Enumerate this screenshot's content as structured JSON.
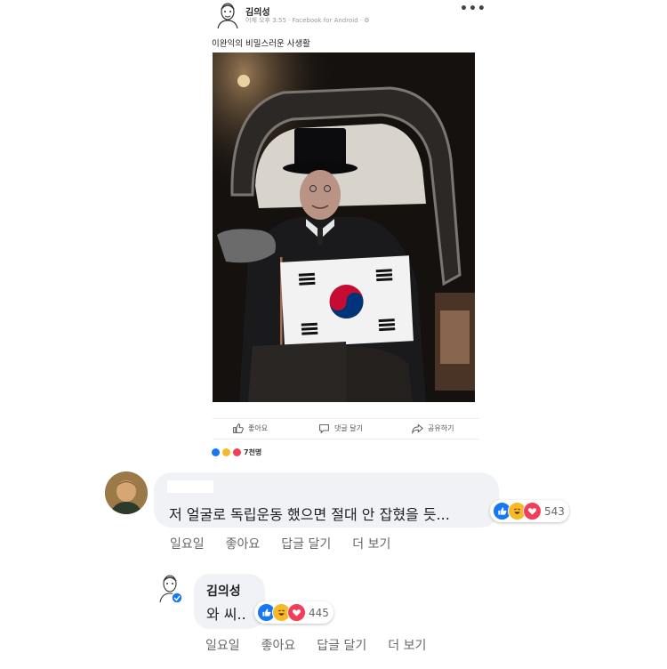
{
  "post": {
    "author": "김의성",
    "meta": "어제 오후 3:55 · Facebook for Android · ⚙",
    "more": "•••",
    "text": "이완익의 비밀스러운 사생활",
    "actions": [
      {
        "label": "좋아요",
        "icon": "thumbs-up-icon"
      },
      {
        "label": "댓글 달기",
        "icon": "comment-icon"
      },
      {
        "label": "공유하기",
        "icon": "share-icon"
      }
    ],
    "reactions_count": "7천명"
  },
  "comment1": {
    "text": "저 얼굴로 독립운동 했으면 절대 안 잡혔을 듯...",
    "reactions_count": "543",
    "actions": [
      "일요일",
      "좋아요",
      "답글 달기",
      "더 보기"
    ]
  },
  "comment2": {
    "author": "김의성",
    "text": "와 씨..",
    "reactions_count": "445",
    "actions": [
      "일요일",
      "좋아요",
      "답글 달기",
      "더 보기"
    ]
  },
  "colors": {
    "like_blue": "#1877f2",
    "haha_yellow": "#f7b928",
    "love_red": "#f33e58",
    "bubble_gray": "#f0f2f5",
    "secondary_text": "#65676b"
  }
}
